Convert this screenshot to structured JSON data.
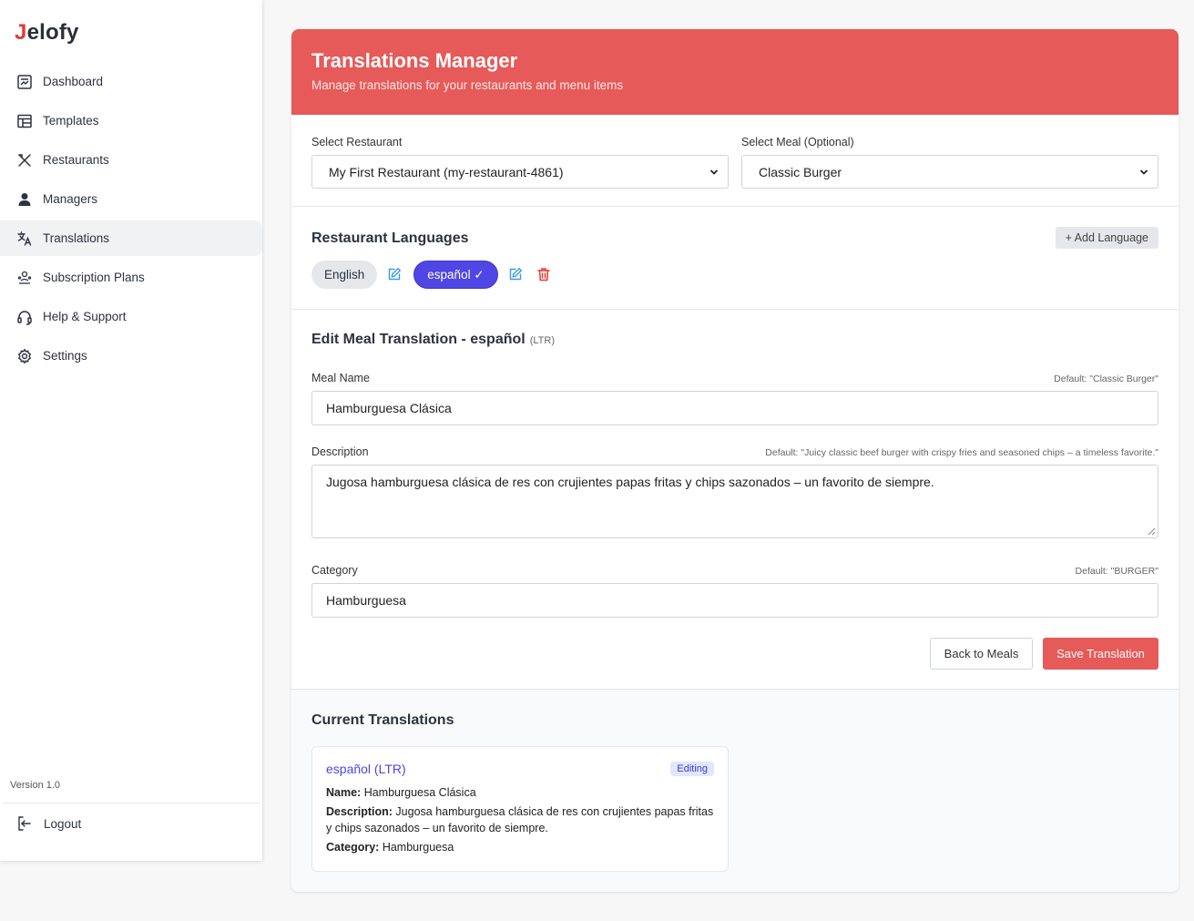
{
  "brand": {
    "first": "J",
    "rest": "elofy"
  },
  "sidebar": {
    "items": [
      {
        "label": "Dashboard",
        "icon": "dashboard-icon"
      },
      {
        "label": "Templates",
        "icon": "templates-icon"
      },
      {
        "label": "Restaurants",
        "icon": "utensils-icon"
      },
      {
        "label": "Managers",
        "icon": "user-icon"
      },
      {
        "label": "Translations",
        "icon": "translate-icon"
      },
      {
        "label": "Subscription Plans",
        "icon": "subscription-icon"
      },
      {
        "label": "Help & Support",
        "icon": "headset-icon"
      },
      {
        "label": "Settings",
        "icon": "gear-icon"
      }
    ],
    "active": "Translations",
    "version": "Version 1.0",
    "logout": "Logout"
  },
  "header": {
    "title": "Translations Manager",
    "subtitle": "Manage translations for your restaurants and menu items"
  },
  "selectors": {
    "restaurant_label": "Select Restaurant",
    "restaurant_value": "My First Restaurant (my-restaurant-4861)",
    "meal_label": "Select Meal (Optional)",
    "meal_value": "Classic Burger"
  },
  "languages": {
    "title": "Restaurant Languages",
    "add_label": "+ Add Language",
    "chips": [
      {
        "label": "English"
      },
      {
        "label": "español ✓"
      }
    ]
  },
  "edit": {
    "title": "Edit Meal Translation - español",
    "direction": "(LTR)",
    "name_label": "Meal Name",
    "name_default": "Default: \"Classic Burger\"",
    "name_value": "Hamburguesa Clásica",
    "desc_label": "Description",
    "desc_default": "Default: \"Juicy classic beef burger with crispy fries and seasoned chips – a timeless favorite.\"",
    "desc_value": "Jugosa hamburguesa clásica de res con crujientes papas fritas y chips sazonados – un favorito de siempre.",
    "cat_label": "Category",
    "cat_default": "Default: \"BURGER\"",
    "cat_value": "Hamburguesa",
    "back_label": "Back to Meals",
    "save_label": "Save Translation"
  },
  "current": {
    "title": "Current Translations",
    "card": {
      "lang": "español (LTR)",
      "badge": "Editing",
      "name_key": "Name:",
      "name_val": " Hamburguesa Clásica",
      "desc_key": "Description:",
      "desc_val": " Jugosa hamburguesa clásica de res con crujientes papas fritas y chips sazonados – un favorito de siempre.",
      "cat_key": "Category:",
      "cat_val": " Hamburguesa"
    }
  },
  "colors": {
    "accent": "#e65a5a",
    "primary": "#4f46e5",
    "edit_icon": "#3b9be8",
    "delete_icon": "#e53935"
  }
}
